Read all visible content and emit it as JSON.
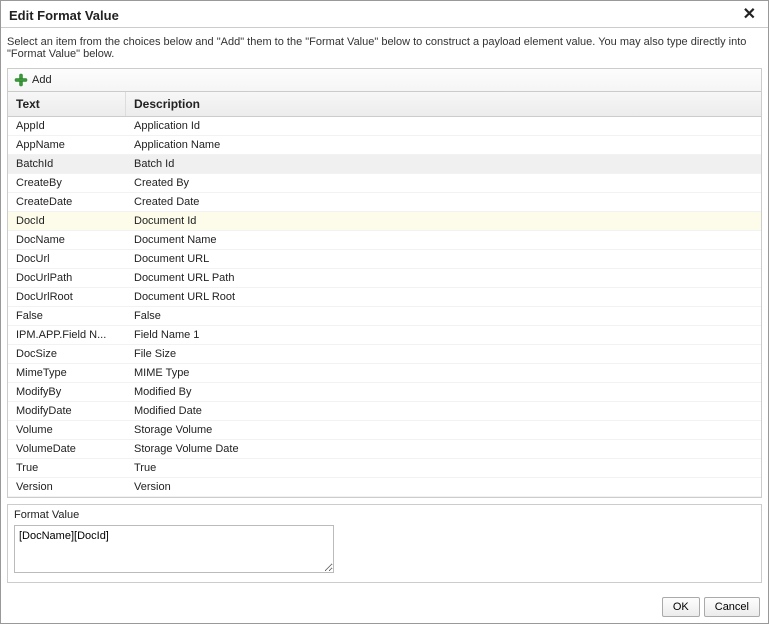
{
  "dialog": {
    "title": "Edit Format Value",
    "instructions": "Select an item from the choices below and \"Add\" them to the \"Format Value\" below to construct a payload element value. You may also type directly into \"Format Value\" below."
  },
  "toolbar": {
    "add_label": "Add"
  },
  "grid": {
    "headers": {
      "text": "Text",
      "description": "Description"
    },
    "rows": [
      {
        "text": "AppId",
        "description": "Application Id",
        "highlight": ""
      },
      {
        "text": "AppName",
        "description": "Application Name",
        "highlight": ""
      },
      {
        "text": "BatchId",
        "description": "Batch Id",
        "highlight": "gray"
      },
      {
        "text": "CreateBy",
        "description": "Created By",
        "highlight": ""
      },
      {
        "text": "CreateDate",
        "description": "Created Date",
        "highlight": ""
      },
      {
        "text": "DocId",
        "description": "Document Id",
        "highlight": "yellow"
      },
      {
        "text": "DocName",
        "description": "Document Name",
        "highlight": ""
      },
      {
        "text": "DocUrl",
        "description": "Document URL",
        "highlight": ""
      },
      {
        "text": "DocUrlPath",
        "description": "Document URL Path",
        "highlight": ""
      },
      {
        "text": "DocUrlRoot",
        "description": "Document URL Root",
        "highlight": ""
      },
      {
        "text": "False",
        "description": "False",
        "highlight": ""
      },
      {
        "text": "IPM.APP.Field N...",
        "description": "Field Name 1",
        "highlight": ""
      },
      {
        "text": "DocSize",
        "description": "File Size",
        "highlight": ""
      },
      {
        "text": "MimeType",
        "description": "MIME Type",
        "highlight": ""
      },
      {
        "text": "ModifyBy",
        "description": "Modified By",
        "highlight": ""
      },
      {
        "text": "ModifyDate",
        "description": "Modified Date",
        "highlight": ""
      },
      {
        "text": "Volume",
        "description": "Storage Volume",
        "highlight": ""
      },
      {
        "text": "VolumeDate",
        "description": "Storage Volume Date",
        "highlight": ""
      },
      {
        "text": "True",
        "description": "True",
        "highlight": ""
      },
      {
        "text": "Version",
        "description": "Version",
        "highlight": ""
      }
    ]
  },
  "format": {
    "label": "Format Value",
    "value": "[DocName][DocId]"
  },
  "buttons": {
    "ok": "OK",
    "cancel": "Cancel"
  }
}
